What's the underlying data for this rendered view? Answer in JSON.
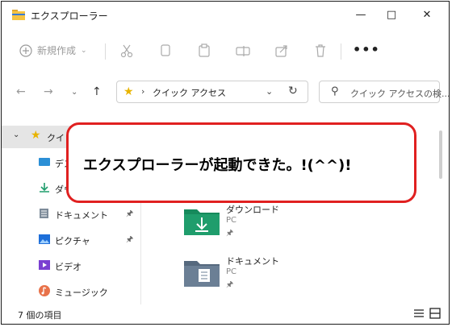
{
  "window": {
    "title": "エクスプローラー"
  },
  "toolbar": {
    "new_label": "新規作成",
    "more_label": "•••"
  },
  "address": {
    "path": "クイック アクセス"
  },
  "search": {
    "placeholder": "クイック アクセスの検..."
  },
  "sidebar": {
    "items": [
      {
        "label": "クイッ",
        "icon": "star-icon",
        "pinned": false
      },
      {
        "label": "デス",
        "icon": "desktop-icon",
        "pinned": false
      },
      {
        "label": "ダウ",
        "icon": "download-icon",
        "pinned": false
      },
      {
        "label": "ドキュメント",
        "icon": "document-icon",
        "pinned": true
      },
      {
        "label": "ピクチャ",
        "icon": "picture-icon",
        "pinned": true
      },
      {
        "label": "ビデオ",
        "icon": "video-icon",
        "pinned": false
      },
      {
        "label": "ミュージック",
        "icon": "music-icon",
        "pinned": false
      }
    ]
  },
  "content": {
    "items": [
      {
        "name": "ダウンロード",
        "location": "PC"
      },
      {
        "name": "ドキュメント",
        "location": "PC"
      }
    ]
  },
  "status": {
    "item_count": "7 個の項目"
  },
  "callout": {
    "text": "エクスプローラーが起動できた。!(^^)!"
  },
  "colors": {
    "callout_border": "#e02020",
    "folder_green": "#1f9d6c",
    "folder_gray": "#6b7f95",
    "star": "#e8b400"
  }
}
